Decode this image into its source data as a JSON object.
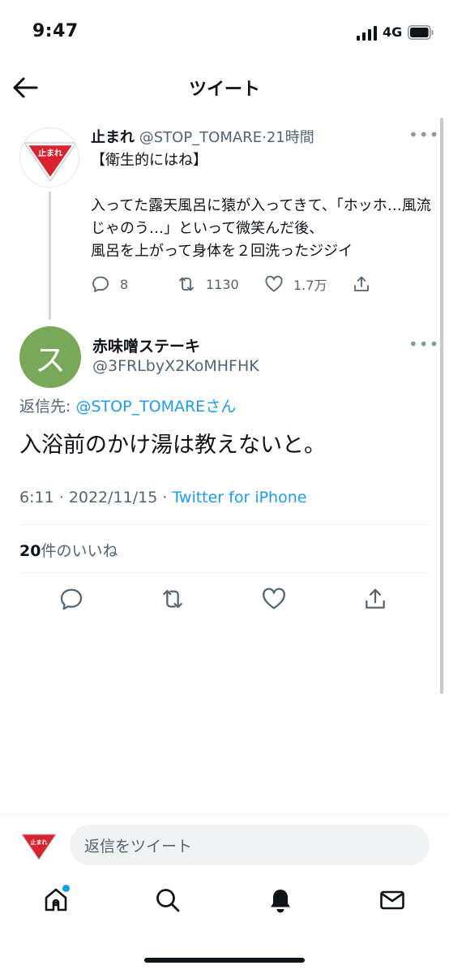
{
  "status_bar": {
    "time": "9:47",
    "network": "4G"
  },
  "header": {
    "title": "ツイート"
  },
  "parent_tweet": {
    "avatar_text": "止まれ",
    "name": "止まれ",
    "handle": "@STOP_TOMARE",
    "separator": "·",
    "time_ago": "21時間",
    "body": "【衛生的にはね】\n\n入ってた露天風呂に猿が入ってきて、「ホッホ…風流じゃのう…」といって微笑んだ後、\n風呂を上がって身体を２回洗ったジジイ",
    "replies": "8",
    "retweets": "1130",
    "likes": "1.7万"
  },
  "reply_tweet": {
    "avatar_letter": "ス",
    "name": "赤味噌ステーキ",
    "handle": "@3FRLbyX2KoMHFHK",
    "reply_to_label": "返信先: ",
    "reply_to_mention": "@STOP_TOMARE",
    "reply_to_suffix": "さん",
    "text": "入浴前のかけ湯は教えないと。",
    "time": "6:11",
    "dot": " · ",
    "date": "2022/11/15",
    "source": "Twitter for iPhone",
    "likes_count": "20",
    "likes_label": "件のいいね"
  },
  "composer": {
    "avatar_text": "止まれ",
    "placeholder": "返信をツイート"
  },
  "colors": {
    "accent": "#1d9bf0",
    "avatar_green": "#79a85a",
    "stop_red": "#d9232e"
  },
  "icons": {
    "back": "arrow-left-icon",
    "more": "more-dots-icon",
    "reply": "comment-icon",
    "retweet": "retweet-icon",
    "like": "heart-icon",
    "share": "share-icon",
    "home": "home-icon",
    "search": "search-icon",
    "notifications": "bell-icon",
    "messages": "envelope-icon"
  }
}
